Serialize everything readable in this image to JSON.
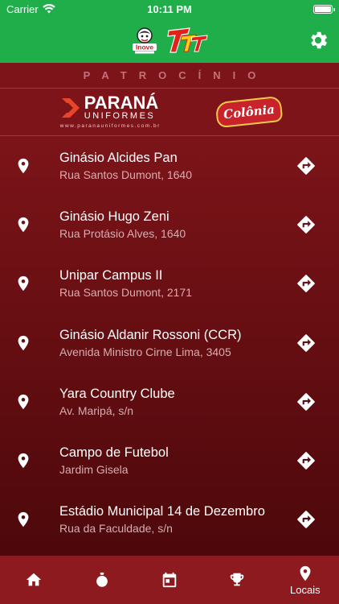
{
  "status_bar": {
    "carrier": "Carrier",
    "time": "10:11 PM"
  },
  "header": {
    "logo_left": "inove",
    "logo_right": "TTT",
    "settings_icon": "gear-icon"
  },
  "sponsors": {
    "title": "PATROCÍNIO",
    "parana": {
      "name": "PARANÁ",
      "sub": "UNIFORMES",
      "url": "www.paranauniformes.com.br"
    },
    "colonia": "Colônia"
  },
  "locations": [
    {
      "name": "Ginásio Alcides Pan",
      "address": "Rua Santos Dumont, 1640"
    },
    {
      "name": "Ginásio Hugo Zeni",
      "address": "Rua Protásio Alves, 1640"
    },
    {
      "name": "Unipar Campus II",
      "address": "Rua Santos Dumont, 2171"
    },
    {
      "name": "Ginásio Aldanir Rossoni (CCR)",
      "address": "Avenida Ministro Cirne Lima, 3405"
    },
    {
      "name": "Yara Country Clube",
      "address": "Av. Maripá, s/n"
    },
    {
      "name": "Campo de Futebol",
      "address": "Jardim Gisela"
    },
    {
      "name": "Estádio Municipal 14 de Dezembro",
      "address": "Rua da Faculdade, s/n"
    }
  ],
  "tabs": [
    {
      "icon": "home-icon",
      "label": ""
    },
    {
      "icon": "ball-icon",
      "label": ""
    },
    {
      "icon": "calendar-icon",
      "label": ""
    },
    {
      "icon": "trophy-icon",
      "label": ""
    },
    {
      "icon": "location-pin-icon",
      "label": "Locais",
      "active": true
    }
  ],
  "colors": {
    "header_green": "#1fae4a",
    "maroon": "#7c1419",
    "tabbar": "#8d1a1e"
  }
}
